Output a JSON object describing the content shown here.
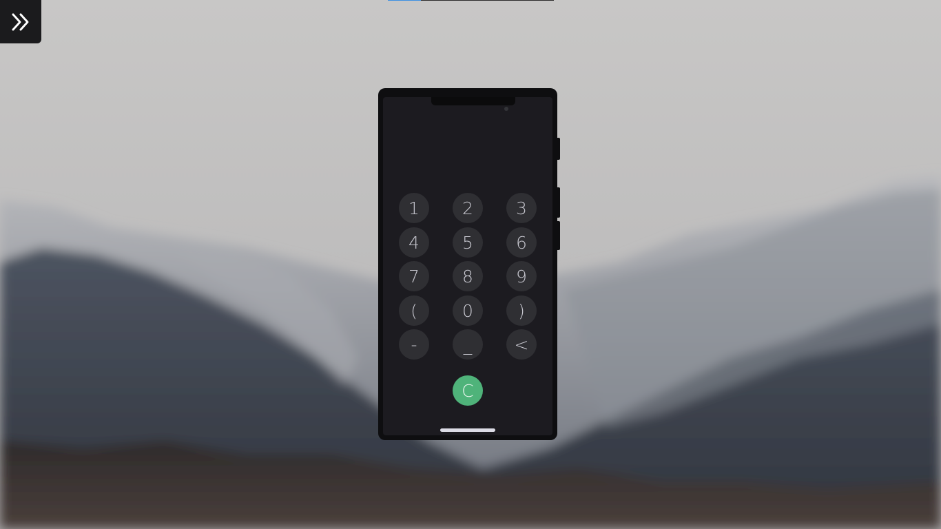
{
  "progress": {
    "fraction": 0.2
  },
  "menu_toggle": {
    "icon": "double-chevron-right-icon"
  },
  "keypad": {
    "keys": [
      "1",
      "2",
      "3",
      "4",
      "5",
      "6",
      "7",
      "8",
      "9",
      "(",
      "0",
      ")",
      "-",
      "_",
      "<"
    ],
    "clear_label": "C"
  },
  "colors": {
    "accent": "#3b8fe3",
    "clear_button": "#4fb37a",
    "key_background": "#2f2f33",
    "screen_background": "#1c1b20"
  }
}
